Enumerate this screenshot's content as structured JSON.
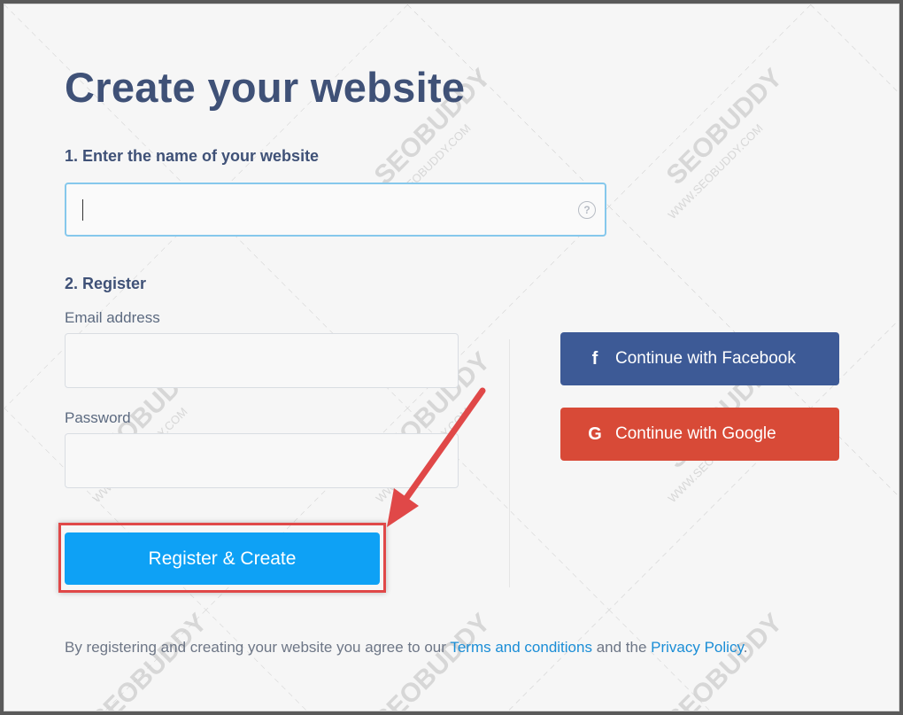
{
  "title": "Create your website",
  "step1": {
    "label": "1. Enter the name of your website",
    "input_value": "",
    "help_icon": "question-circle-icon"
  },
  "step2": {
    "label": "2. Register",
    "email_label": "Email address",
    "password_label": "Password",
    "email_value": "",
    "password_value": ""
  },
  "register_button": "Register & Create",
  "social": {
    "facebook_label": "Continue with Facebook",
    "facebook_icon": "facebook-icon",
    "google_label": "Continue with Google",
    "google_icon": "google-icon"
  },
  "footer": {
    "prefix": "By registering and creating your website you agree to our ",
    "terms_link": "Terms and conditions",
    "middle": " and the ",
    "privacy_link": "Privacy Policy",
    "suffix": "."
  },
  "watermark": "SEOBUDDY",
  "watermark_sub": "WWW.SEOBUDDY.COM",
  "colors": {
    "title": "#3f5177",
    "facebook": "#3d5a96",
    "google": "#d84a37",
    "primary": "#0ea1f5",
    "annotation": "#e04848",
    "link": "#1a8dd6"
  }
}
